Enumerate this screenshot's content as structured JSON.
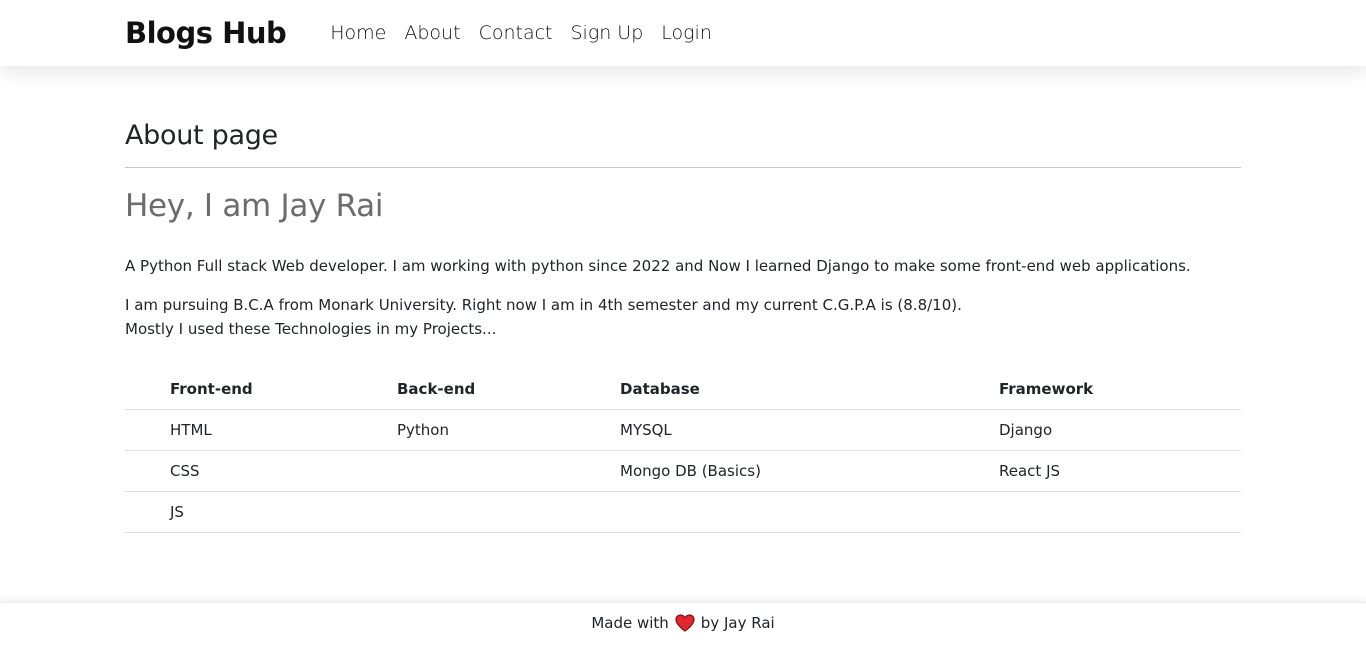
{
  "navbar": {
    "brand": "Blogs Hub",
    "links": [
      "Home",
      "About",
      "Contact",
      "Sign Up",
      "Login"
    ]
  },
  "main": {
    "page_title": "About page",
    "greeting": "Hey, I am Jay Rai",
    "paragraph1": "A Python Full stack Web developer. I am working with python since 2022 and Now I learned Django to make some front-end web applications.",
    "paragraph2_line1": "I am pursuing B.C.A from Monark University. Right now I am in 4th semester and my current C.G.P.A is (8.8/10).",
    "paragraph2_line2": "Mostly I used these Technologies in my Projects...",
    "table": {
      "headers": [
        "Front-end",
        "Back-end",
        "Database",
        "Framework"
      ],
      "rows": [
        [
          "HTML",
          "Python",
          "MYSQL",
          "Django"
        ],
        [
          "CSS",
          "",
          "Mongo DB (Basics)",
          "React JS"
        ],
        [
          "JS",
          "",
          "",
          ""
        ]
      ]
    }
  },
  "footer": {
    "made_with": "Made with",
    "by": "by Jay Rai",
    "heart_icon": "heart-icon",
    "heart_color": "#e3262f"
  }
}
